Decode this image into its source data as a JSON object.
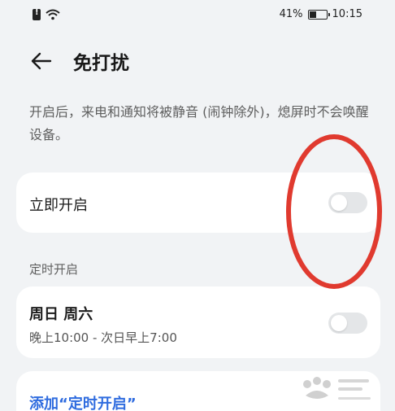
{
  "status_bar": {
    "battery": "41%",
    "time": "10:15"
  },
  "header": {
    "title": "免打扰"
  },
  "description": "开启后，来电和通知将被静音 (闹钟除外)，熄屏时不会唤醒设备。",
  "immediate": {
    "label": "立即开启",
    "enabled": false
  },
  "schedule": {
    "section_label": "定时开启",
    "days": "周日 周六",
    "time_range": "晚上10:00 - 次日早上7:00",
    "enabled": false
  },
  "add_schedule": {
    "label": "添加“定时开启”"
  },
  "colors": {
    "background": "#f1f3f5",
    "card": "#ffffff",
    "accent": "#2f6cdf",
    "annotation": "#e03a2f",
    "toggle_off": "#e4e6e8"
  }
}
